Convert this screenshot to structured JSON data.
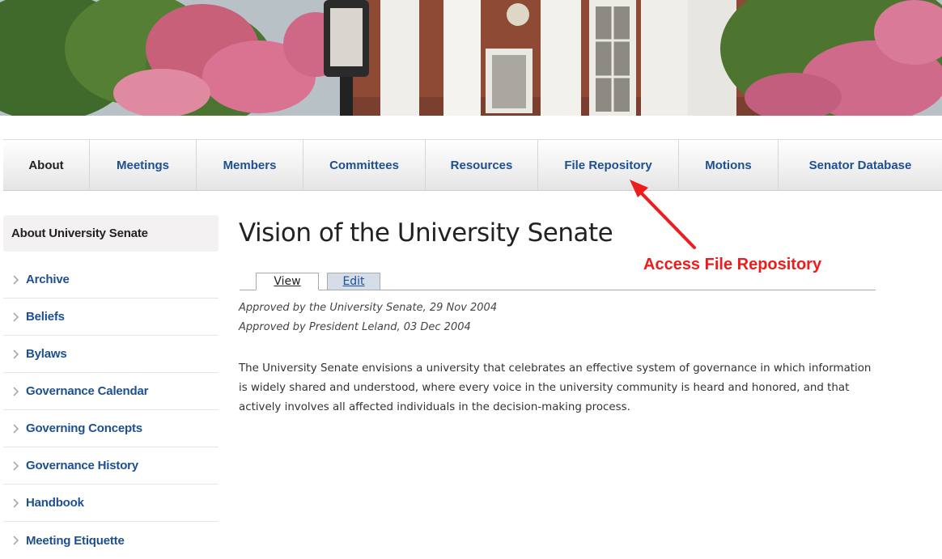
{
  "nav": {
    "items": [
      {
        "label": "About"
      },
      {
        "label": "Meetings"
      },
      {
        "label": "Members"
      },
      {
        "label": "Committees"
      },
      {
        "label": "Resources"
      },
      {
        "label": "File Repository"
      },
      {
        "label": "Motions"
      },
      {
        "label": "Senator Database"
      }
    ]
  },
  "sidebar": {
    "title": "About University Senate",
    "items": [
      {
        "label": "Archive"
      },
      {
        "label": "Beliefs"
      },
      {
        "label": "Bylaws"
      },
      {
        "label": "Governance Calendar"
      },
      {
        "label": "Governing Concepts"
      },
      {
        "label": "Governance History"
      },
      {
        "label": "Handbook"
      },
      {
        "label": "Meeting Etiquette"
      }
    ]
  },
  "main": {
    "title": "Vision of the University Senate",
    "tabs": {
      "view": "View",
      "edit": "Edit"
    },
    "approvals": [
      "Approved by the University Senate, 29 Nov 2004",
      "Approved by President Leland, 03 Dec 2004"
    ],
    "body": "The University Senate envisions a university that celebrates an effective system of governance in which information is widely shared and understood, where every voice in the university community is heard and honored, and that actively involves all affected individuals in the decision-making process."
  },
  "annotation": {
    "label": "Access File Repository",
    "color": "#ee1c1c"
  },
  "colors": {
    "link": "#1d4f91",
    "text": "#222222"
  }
}
